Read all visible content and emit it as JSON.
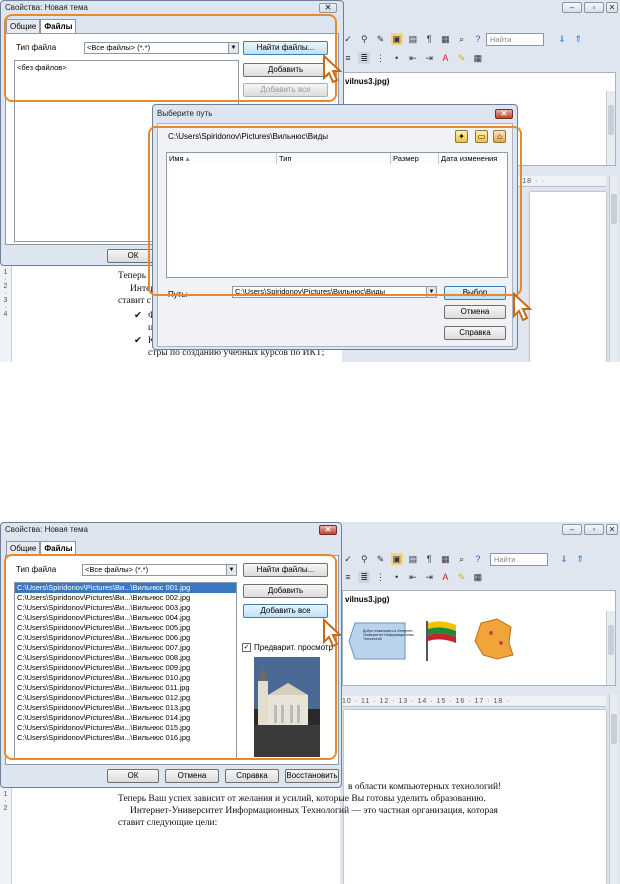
{
  "writer": {
    "window_buttons": [
      "–",
      "▫",
      "✕"
    ],
    "search_placeholder": "Найти",
    "filename_fragment": "vilnus3.jpg)",
    "ruler_top": "· 18 · ·",
    "ruler_bottom": "10 · 11 · 12 · 13 · 14 · 15 · 16 · 17 · 18 ·",
    "text_top": [
      "Теперь I",
      "Интер",
      "ставит с",
      "Ф",
      "ц",
      "К",
      "стры по созданию учебных курсов по ИКТ;"
    ],
    "text_bottom": [
      "в области компьютерных технологий!",
      "Теперь Ваш успех зависит от желания и усилий, которые Вы готовы уделить образованию.",
      "Интернет-Университет Информационных Технологий — это частная организация, которая",
      "ставит следующие цели:"
    ],
    "thumbnail_caption": "Добро пожаловать в Интернет-Университет Информационных Технологий"
  },
  "dialog1": {
    "title": "Свойства: Новая тема",
    "tabs": [
      "Общие",
      "Файлы"
    ],
    "filetype_label": "Тип файла",
    "filetype_value": "<Все файлы> (*.*)",
    "empty_list": "<без файлов>",
    "find_button": "Найти файлы...",
    "add_button": "Добавить",
    "add_all_button": "Добавить все",
    "ok_button": "ОК"
  },
  "path_dialog": {
    "title": "Выберите путь",
    "current_path": "C:\\Users\\Spiridonov\\Pictures\\Вильнюс\\Виды",
    "columns": [
      "Имя",
      "Тип",
      "Размер",
      "Дата изменения"
    ],
    "path_label": "Путь:",
    "path_value": "C:\\Users\\Spiridonov\\Pictures\\Вильнюс\\Виды",
    "select_button": "Выбор",
    "cancel_button": "Отмена",
    "help_button": "Справка"
  },
  "dialog2": {
    "title": "Свойства: Новая тема",
    "tabs": [
      "Общие",
      "Файлы"
    ],
    "filetype_label": "Тип файла",
    "filetype_value": "<Все файлы> (*.*)",
    "files": [
      "C:\\Users\\Spiridonov\\Pictures\\Ви...\\Вильнюс 001.jpg",
      "C:\\Users\\Spiridonov\\Pictures\\Ви...\\Вильнюс 002.jpg",
      "C:\\Users\\Spiridonov\\Pictures\\Ви...\\Вильнюс 003.jpg",
      "C:\\Users\\Spiridonov\\Pictures\\Ви...\\Вильнюс 004.jpg",
      "C:\\Users\\Spiridonov\\Pictures\\Ви...\\Вильнюс 005.jpg",
      "C:\\Users\\Spiridonov\\Pictures\\Ви...\\Вильнюс 006.jpg",
      "C:\\Users\\Spiridonov\\Pictures\\Ви...\\Вильнюс 007.jpg",
      "C:\\Users\\Spiridonov\\Pictures\\Ви...\\Вильнюс 008.jpg",
      "C:\\Users\\Spiridonov\\Pictures\\Ви...\\Вильнюс 009.jpg",
      "C:\\Users\\Spiridonov\\Pictures\\Ви...\\Вильнюс 010.jpg",
      "C:\\Users\\Spiridonov\\Pictures\\Ви...\\Вильнюс 011.jpg",
      "C:\\Users\\Spiridonov\\Pictures\\Ви...\\Вильнюс 012.jpg",
      "C:\\Users\\Spiridonov\\Pictures\\Ви...\\Вильнюс 013.jpg",
      "C:\\Users\\Spiridonov\\Pictures\\Ви...\\Вильнюс 014.jpg",
      "C:\\Users\\Spiridonov\\Pictures\\Ви...\\Вильнюс 015.jpg",
      "C:\\Users\\Spiridonov\\Pictures\\Ви...\\Вильнюс 016.jpg"
    ],
    "find_button": "Найти файлы...",
    "add_button": "Добавить",
    "add_all_button": "Добавить все",
    "preview_label": "Предварит. просмотр",
    "ok_button": "ОК",
    "cancel_button": "Отмена",
    "help_button": "Справка",
    "restore_button": "Восстановить"
  },
  "colors": {
    "highlight": "#e68a2e",
    "selection": "#3a78c3"
  }
}
